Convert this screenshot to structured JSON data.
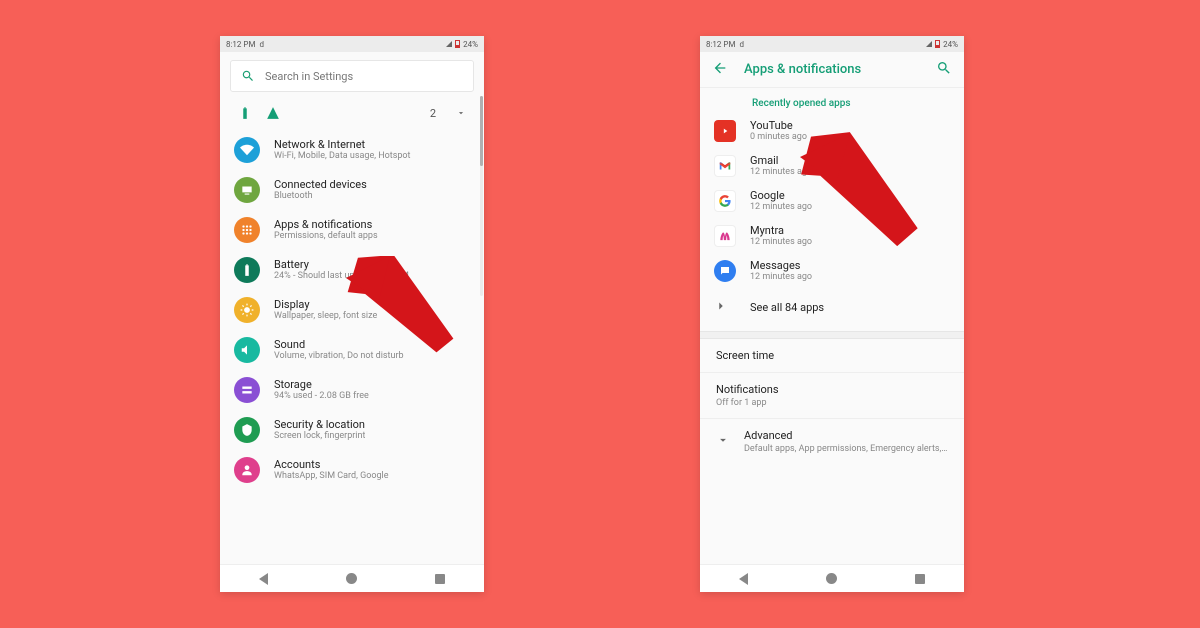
{
  "colors": {
    "background": "#f75f57",
    "accent": "#159e76",
    "arrow": "#d4151a"
  },
  "statusbar": {
    "time": "8:12 PM",
    "carrier_icon": "d",
    "battery_pct": "24%"
  },
  "left": {
    "search_placeholder": "Search in Settings",
    "quick_count": "2",
    "items": [
      {
        "title": "Network & Internet",
        "sub": "Wi-Fi, Mobile, Data usage, Hotspot",
        "color": "#1da0d8",
        "icon": "wifi"
      },
      {
        "title": "Connected devices",
        "sub": "Bluetooth",
        "color": "#6fa63f",
        "icon": "devices"
      },
      {
        "title": "Apps & notifications",
        "sub": "Permissions, default apps",
        "color": "#f0822b",
        "icon": "apps"
      },
      {
        "title": "Battery",
        "sub": "24% - Should last until about …AM",
        "color": "#0e7a5a",
        "icon": "battery"
      },
      {
        "title": "Display",
        "sub": "Wallpaper, sleep, font size",
        "color": "#f0b12b",
        "icon": "display"
      },
      {
        "title": "Sound",
        "sub": "Volume, vibration, Do not disturb",
        "color": "#18b9a0",
        "icon": "sound"
      },
      {
        "title": "Storage",
        "sub": "94% used - 2.08 GB free",
        "color": "#8a4fd4",
        "icon": "storage"
      },
      {
        "title": "Security & location",
        "sub": "Screen lock, fingerprint",
        "color": "#1f9c52",
        "icon": "security"
      },
      {
        "title": "Accounts",
        "sub": "WhatsApp, SIM Card, Google",
        "color": "#df3f8c",
        "icon": "accounts"
      }
    ]
  },
  "right": {
    "header_title": "Apps & notifications",
    "section_label": "Recently opened apps",
    "apps": [
      {
        "title": "YouTube",
        "sub": "0 minutes ago",
        "bg": "#e43225",
        "icon": "youtube"
      },
      {
        "title": "Gmail",
        "sub": "12 minutes ago",
        "bg": "#ffffff",
        "icon": "gmail"
      },
      {
        "title": "Google",
        "sub": "12 minutes ago",
        "bg": "#ffffff",
        "icon": "google"
      },
      {
        "title": "Myntra",
        "sub": "12 minutes ago",
        "bg": "#ffffff",
        "icon": "myntra"
      },
      {
        "title": "Messages",
        "sub": "12 minutes ago",
        "bg": "#2f7ef0",
        "icon": "messages"
      }
    ],
    "see_all": "See all 84 apps",
    "screen_time": "Screen time",
    "notifications_title": "Notifications",
    "notifications_sub": "Off for 1 app",
    "advanced_title": "Advanced",
    "advanced_sub": "Default apps, App permissions, Emergency alerts, S…"
  }
}
